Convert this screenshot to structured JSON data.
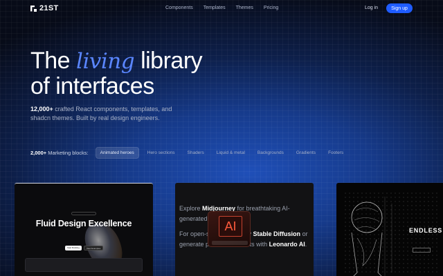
{
  "nav": {
    "logo_text": "21ST",
    "links": [
      "Components",
      "Templates",
      "Themes",
      "Pricing"
    ],
    "login_label": "Log in",
    "signup_label": "Sign up"
  },
  "hero": {
    "headline_part1": "The ",
    "headline_accent": "living",
    "headline_part2": " library",
    "headline_line2": "of interfaces",
    "subtitle_count": "12,000+",
    "subtitle_rest": " crafted React components, templates, and shadcn themes. Built by real design engineers."
  },
  "blocks": {
    "count": "2,000+",
    "label": " Marketing blocks:",
    "chips": [
      "Animated heroes",
      "Hero sections",
      "Shaders",
      "Liquid & metal",
      "Backgrounds",
      "Gradients",
      "Footers"
    ],
    "active_index": 0
  },
  "cards": {
    "card1": {
      "title": "Fluid Design Excellence",
      "btn_primary": "Start Building",
      "btn_secondary": "View Examples"
    },
    "card2": {
      "line1_pre": "Explore ",
      "line1_bold": "Midjourney",
      "line1_post": " for breathtaking AI-generated illustrations.",
      "line2_pre": "For open-source creativity ",
      "line2_bold1": "Stable Diffusion",
      "line2_mid": " or generate production assets with ",
      "line2_bold2": "Leonardo AI",
      "line2_post": ".",
      "overlay_glyph": "AI"
    },
    "card3": {
      "title": "ENDLESS"
    }
  },
  "colors": {
    "accent": "#5a86ff",
    "signup_bg": "#1f5cff",
    "ai_glyph": "#ff5a3c"
  }
}
